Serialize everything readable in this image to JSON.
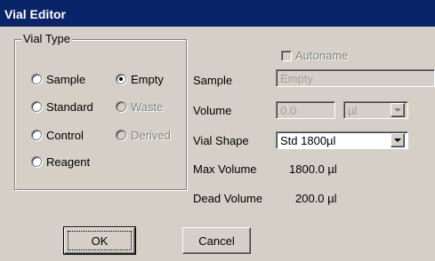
{
  "title": "Vial Editor",
  "vial_type": {
    "title": "Vial Type",
    "options": [
      {
        "label": "Sample",
        "selected": false,
        "disabled": false
      },
      {
        "label": "Empty",
        "selected": true,
        "disabled": false
      },
      {
        "label": "Standard",
        "selected": false,
        "disabled": false
      },
      {
        "label": "Waste",
        "selected": false,
        "disabled": true
      },
      {
        "label": "Control",
        "selected": false,
        "disabled": false
      },
      {
        "label": "Derived",
        "selected": false,
        "disabled": true
      },
      {
        "label": "Reagent",
        "selected": false,
        "disabled": false
      }
    ]
  },
  "autoname": {
    "label": "Autoname",
    "checked": false
  },
  "sample": {
    "label": "Sample",
    "value": "Empty"
  },
  "volume": {
    "label": "Volume",
    "value": "0.0",
    "unit": "µl"
  },
  "vial_shape": {
    "label": "Vial Shape",
    "value": "Std 1800µl"
  },
  "max_volume": {
    "label": "Max Volume",
    "value": "1800.0 µl"
  },
  "dead_volume": {
    "label": "Dead Volume",
    "value": "200.0 µl"
  },
  "buttons": {
    "ok": "OK",
    "cancel": "Cancel"
  }
}
